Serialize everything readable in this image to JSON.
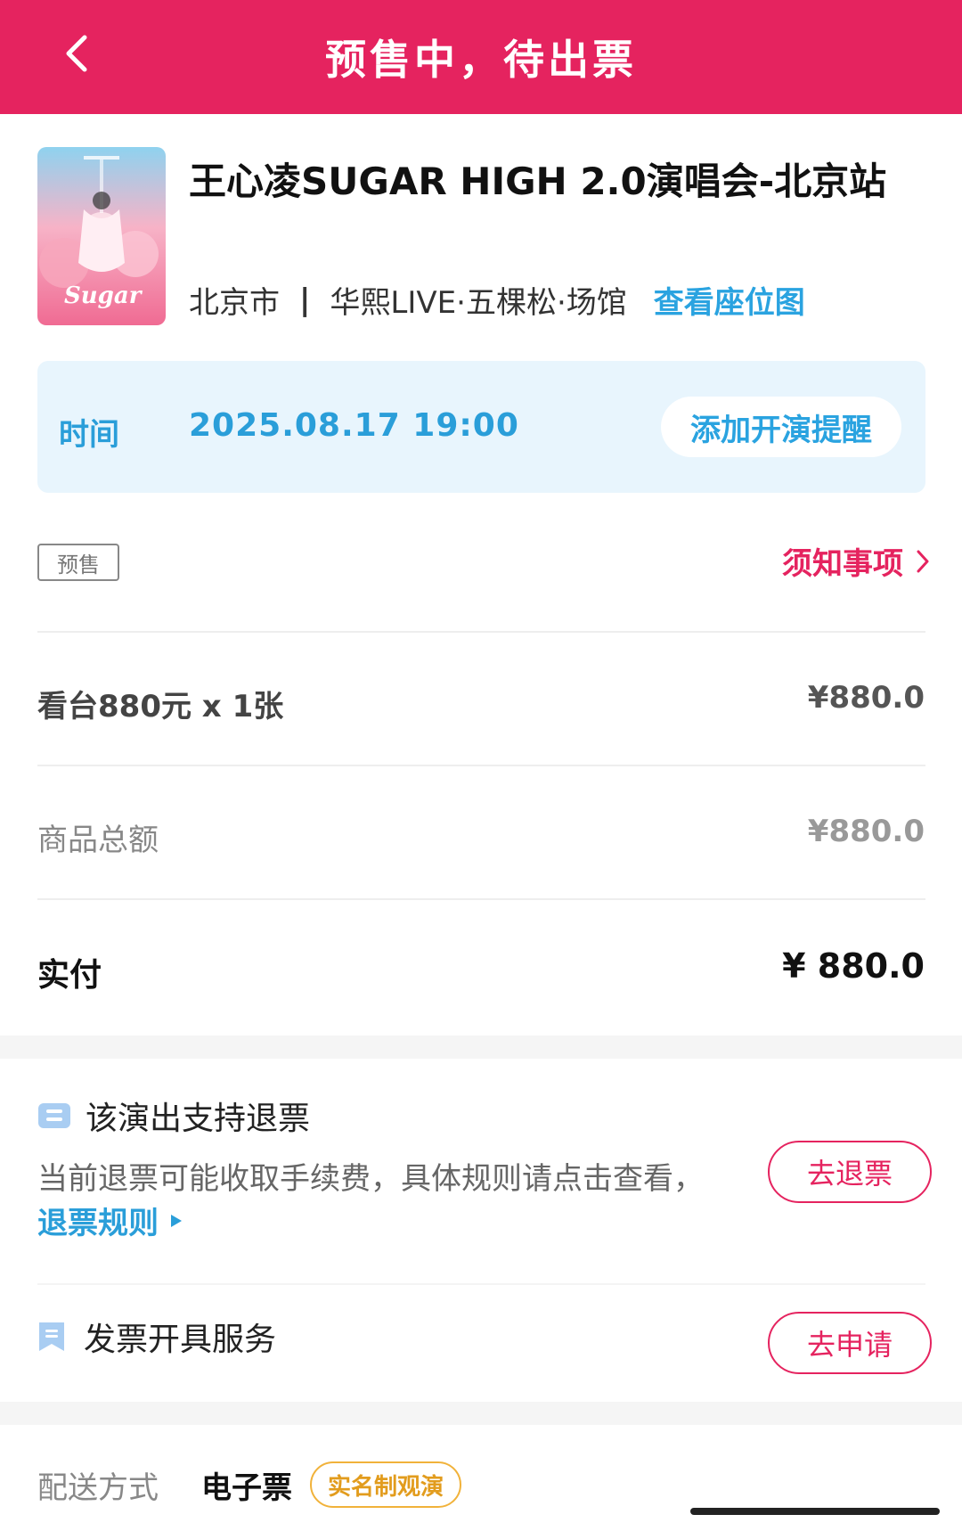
{
  "header": {
    "title": "预售中，待出票",
    "background": "#e5235f"
  },
  "event": {
    "title": "王心凌SUGAR HIGH 2.0演唱会-北京站",
    "city": "北京市",
    "separator": "|",
    "venue": "华熙LIVE·五棵松·场馆",
    "seat_map_link": "查看座位图"
  },
  "time": {
    "label": "时间",
    "value": "2025.08.17 19:00",
    "remind_button": "添加开演提醒"
  },
  "presale_tag": "预售",
  "notice_link": "须知事项",
  "order": {
    "ticket_line": "看台880元 x 1张",
    "ticket_price": "¥880.0",
    "subtotal_label": "商品总额",
    "subtotal_value": "¥880.0",
    "paid_label": "实付",
    "paid_value": "¥ 880.0"
  },
  "refund": {
    "title": "该演出支持退票",
    "description": "当前退票可能收取手续费，具体规则请点击查看，",
    "rule_link": "退票规则",
    "button": "去退票"
  },
  "invoice": {
    "title": "发票开具服务",
    "button": "去申请"
  },
  "delivery": {
    "label": "配送方式",
    "value": "电子票",
    "tag": "实名制观演"
  },
  "colors": {
    "accent": "#e5235f",
    "link_blue": "#2aa3e0",
    "tag_orange": "#e29c1d"
  }
}
